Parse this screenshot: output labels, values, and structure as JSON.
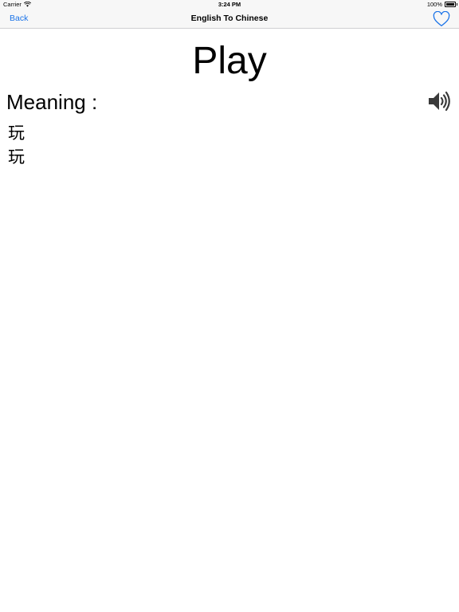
{
  "status_bar": {
    "carrier": "Carrier",
    "time": "3:24 PM",
    "battery": "100%"
  },
  "nav": {
    "back_label": "Back",
    "title": "English To Chinese",
    "favorite_icon": "heart-outline-icon"
  },
  "word": "Play",
  "meaning_label": "Meaning :",
  "speaker_icon": "speaker-icon",
  "meanings": [
    "玩",
    "玩"
  ],
  "colors": {
    "accent": "#1a73e8",
    "bar_background": "#f7f7f7",
    "speaker": "#3a3a3a"
  }
}
